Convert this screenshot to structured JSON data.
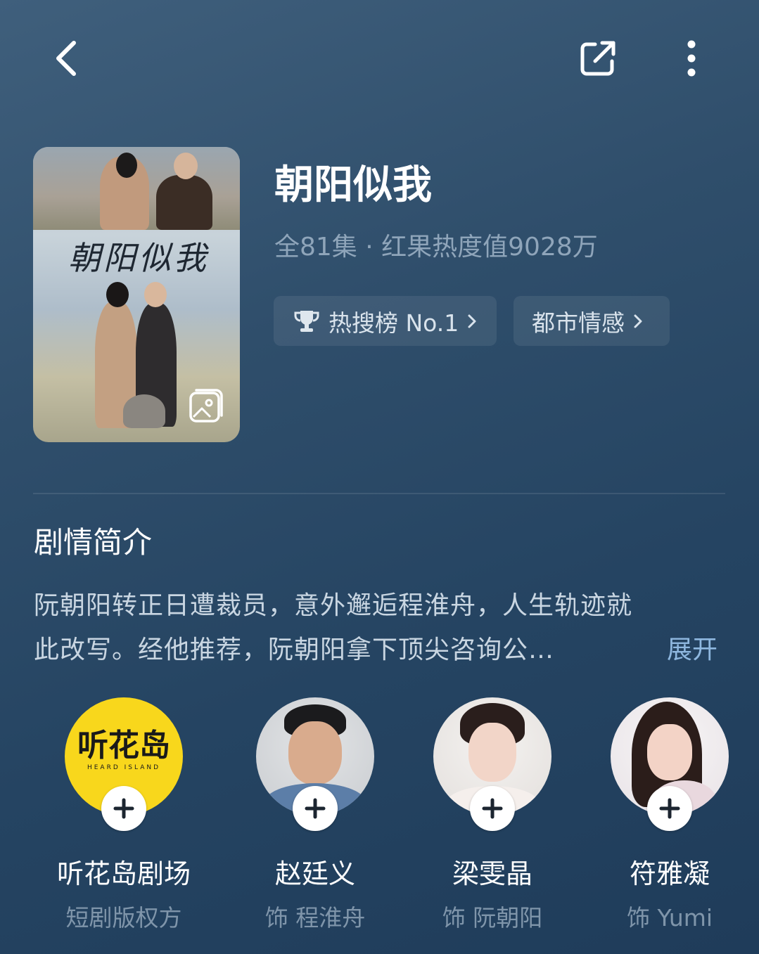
{
  "topbar": {
    "back_icon": "chevron-left-icon",
    "share_icon": "share-external-icon",
    "more_icon": "more-vertical-icon"
  },
  "poster": {
    "title_art": "朝阳似我",
    "gallery_icon": "gallery-icon"
  },
  "show": {
    "title": "朝阳似我",
    "meta": "全81集 · 红果热度值9028万",
    "tags": [
      {
        "icon": "trophy-icon",
        "label": "热搜榜 No.1"
      },
      {
        "label": "都市情感"
      }
    ]
  },
  "synopsis": {
    "heading": "剧情简介",
    "line1": "阮朝阳转正日遭裁员，意外邂逅程淮舟，人生轨迹就",
    "line2": "此改写。经他推荐，阮朝阳拿下顶尖咨询公…",
    "expand_label": "展开"
  },
  "cast": [
    {
      "name": "听花岛剧场",
      "role": "短剧版权方",
      "logo_text": "听花岛",
      "logo_sub": "HEARD ISLAND"
    },
    {
      "name": "赵廷义",
      "role": "饰 程淮舟"
    },
    {
      "name": "梁雯晶",
      "role": "饰 阮朝阳"
    },
    {
      "name": "符雅凝",
      "role": "饰 Yumi"
    }
  ],
  "colors": {
    "accent_link": "#8fb8e0",
    "logo_yellow": "#f8d71c"
  }
}
